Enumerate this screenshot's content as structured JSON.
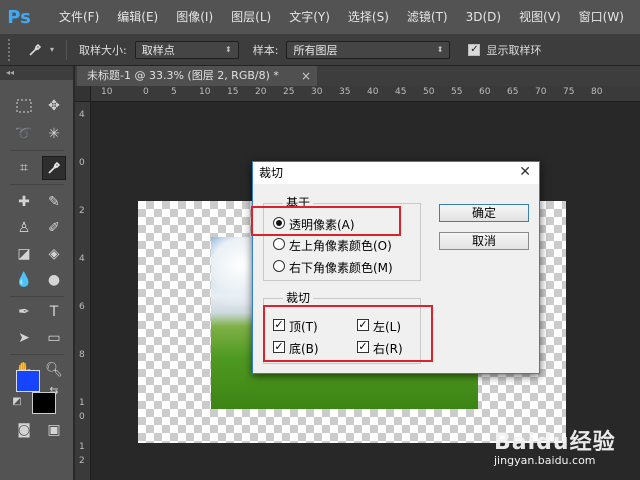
{
  "app": {
    "logo": "Ps"
  },
  "menu": [
    "文件(F)",
    "编辑(E)",
    "图像(I)",
    "图层(L)",
    "文字(Y)",
    "选择(S)",
    "滤镜(T)",
    "3D(D)",
    "视图(V)",
    "窗口(W)"
  ],
  "options": {
    "sample_size_label": "取样大小:",
    "sample_size_value": "取样点",
    "sample_label": "样本:",
    "sample_value": "所有图层",
    "show_ring_label": "显示取样环",
    "show_ring_checked": true
  },
  "document": {
    "tab_title": "未标题-1 @ 33.3% (图层 2, RGB/8) *",
    "close_glyph": "×"
  },
  "ruler_top": [
    "10",
    "5",
    "0",
    "5",
    "10",
    "15",
    "20",
    "25",
    "30",
    "35",
    "40",
    "45",
    "50",
    "55",
    "60",
    "65",
    "70",
    "75",
    "80"
  ],
  "ruler_left": [
    "4",
    "0",
    "2",
    "4",
    "6",
    "8",
    "1",
    "0",
    "1",
    "2"
  ],
  "dialog": {
    "title": "裁切",
    "close_glyph": "✕",
    "based_on": {
      "legend": "基于",
      "options": [
        {
          "label": "透明像素(A)",
          "checked": true
        },
        {
          "label": "左上角像素颜色(O)",
          "checked": false
        },
        {
          "label": "右下角像素颜色(M)",
          "checked": false
        }
      ]
    },
    "trim": {
      "legend": "裁切",
      "items": [
        {
          "label": "顶(T)",
          "checked": true
        },
        {
          "label": "左(L)",
          "checked": true
        },
        {
          "label": "底(B)",
          "checked": true
        },
        {
          "label": "右(R)",
          "checked": true
        }
      ]
    },
    "ok_label": "确定",
    "cancel_label": "取消"
  },
  "colors": {
    "foreground": "#1744ff",
    "background": "#000000",
    "highlight_box": "#d8242a"
  },
  "watermark": {
    "brand": "Baidu经验",
    "url": "jingyan.baidu.com"
  }
}
